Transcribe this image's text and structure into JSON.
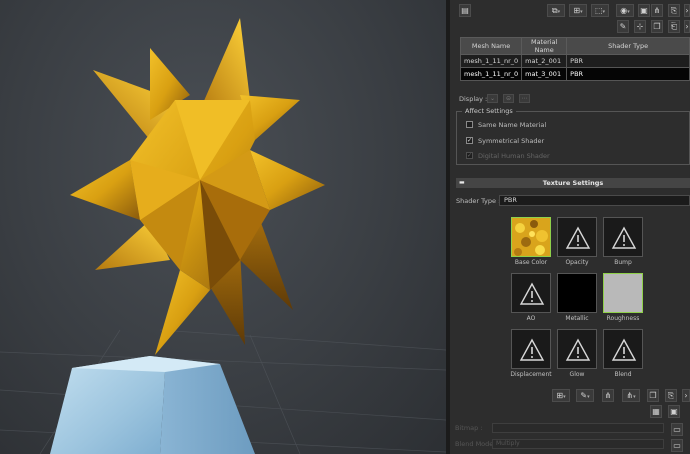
{
  "toolbar": {
    "icons": [
      "material-list-icon",
      "layers-icon",
      "load-icon",
      "save-icon",
      "settings-icon",
      "eyedropper-icon",
      "pick-icon",
      "share-icon",
      "duplicate-icon",
      "export-icon"
    ]
  },
  "table": {
    "headers": [
      "Mesh Name",
      "Material Name",
      "Shader Type"
    ],
    "rows": [
      [
        "mesh_1_11_nr_0",
        "mat_2_001",
        "PBR"
      ],
      [
        "mesh_1_11_nr_0",
        "mat_3_001",
        "PBR"
      ]
    ]
  },
  "display": {
    "label": "Display :"
  },
  "affect_settings": {
    "title": "Affect Settings",
    "options": [
      {
        "label": "Same Name Material",
        "checked": false,
        "enabled": true
      },
      {
        "label": "Symmetrical Shader",
        "checked": true,
        "enabled": true
      },
      {
        "label": "Digital Human Shader",
        "checked": true,
        "enabled": false
      }
    ]
  },
  "texture_settings": {
    "title": "Texture Settings",
    "shader_type_label": "Shader Type :",
    "shader_type_value": "PBR",
    "slots": [
      {
        "label": "Base Color",
        "kind": "texture"
      },
      {
        "label": "Opacity",
        "kind": "warning"
      },
      {
        "label": "Bump",
        "kind": "warning"
      },
      {
        "label": "AO",
        "kind": "warning"
      },
      {
        "label": "Metallic",
        "kind": "black"
      },
      {
        "label": "Roughness",
        "kind": "gray"
      },
      {
        "label": "Displacement",
        "kind": "warning"
      },
      {
        "label": "Glow",
        "kind": "warning"
      },
      {
        "label": "Blend",
        "kind": "warning"
      }
    ]
  },
  "bottom": {
    "bitmap_label": "Bitmap :",
    "blend_mode_label": "Blend Mode :",
    "blend_mode_value": "Multiply"
  },
  "colors": {
    "panel_bg": "#2d2d2d",
    "selected_border": "#8fd14a",
    "star_gold": "#e0a81a",
    "pedestal_blue": "#9fc6e0"
  }
}
